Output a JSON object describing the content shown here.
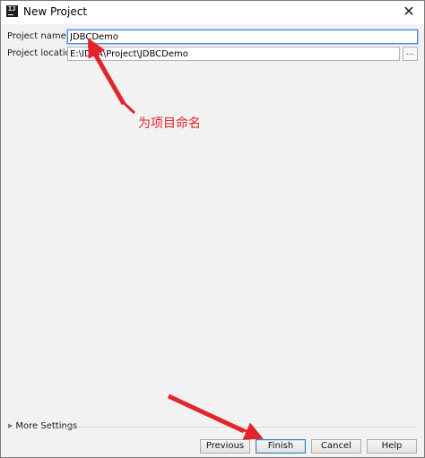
{
  "window": {
    "title": "New Project",
    "close_glyph": "✕",
    "icon": "intellij-idea-icon"
  },
  "form": {
    "name_label": "Project name:",
    "name_value": "JDBCDemo",
    "location_label": "Project location:",
    "location_value": "E:\\IDEA\\Project\\JDBCDemo",
    "browse_label": "..."
  },
  "annotation": {
    "text": "为项目命名",
    "color": "#e0242a"
  },
  "more_settings": {
    "label": "More Settings"
  },
  "buttons": {
    "previous": "Previous",
    "finish": "Finish",
    "cancel": "Cancel",
    "help": "Help"
  }
}
